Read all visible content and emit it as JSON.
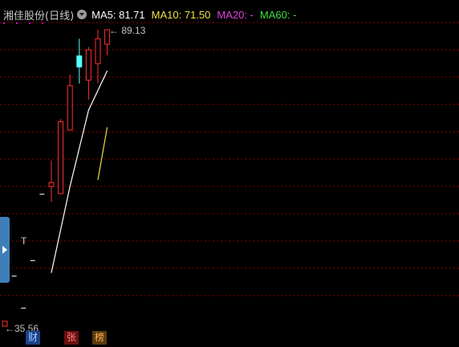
{
  "header": {
    "stock_name": "湘佳股份(日线)",
    "dropdown_icon": "chevron-down-icon",
    "ma5_label": "MA5: 81.71",
    "ma10_label": "MA10: 71.50",
    "ma20_label": "MA20: -",
    "ma60_label": "MA60: -"
  },
  "colors": {
    "background": "#000000",
    "up": "#ff3030",
    "down": "#54ffff",
    "ma5": "#ffffff",
    "ma10": "#f0e040",
    "ma20": "#e040e0",
    "ma60": "#40e040",
    "grid": "#8b0000"
  },
  "labels": {
    "high_price": "89.13",
    "low_price": "35.56",
    "marker_t": "T"
  },
  "tags": {
    "cai": "财",
    "zhang": "张",
    "bang": "榜"
  },
  "chart_data": {
    "type": "candlestick",
    "ylim": [
      35.56,
      89.13
    ],
    "candles": [
      {
        "open": 35.56,
        "close": 36.45,
        "high": 36.45,
        "low": 35.56
      },
      {
        "open": 44.6,
        "close": 44.6,
        "high": 44.6,
        "low": 44.6
      },
      {
        "open": 38.8,
        "close": 38.8,
        "high": 38.8,
        "low": 38.8
      },
      {
        "open": 47.4,
        "close": 47.4,
        "high": 47.4,
        "low": 47.4
      },
      {
        "open": 59.4,
        "close": 59.4,
        "high": 59.4,
        "low": 59.4
      },
      {
        "open": 60.8,
        "close": 61.5,
        "high": 65.5,
        "low": 58.0
      },
      {
        "open": 59.5,
        "close": 72.5,
        "high": 73.0,
        "low": 59.5
      },
      {
        "open": 71.0,
        "close": 79.0,
        "high": 81.0,
        "low": 71.0
      },
      {
        "open": 84.4,
        "close": 82.4,
        "high": 87.5,
        "low": 79.4
      },
      {
        "open": 80.0,
        "close": 85.5,
        "high": 86.0,
        "low": 76.5
      },
      {
        "open": 83.0,
        "close": 87.5,
        "high": 89.13,
        "low": 79.5
      },
      {
        "open": 86.5,
        "close": 89.13,
        "high": 89.13,
        "low": 84.5
      }
    ],
    "ma5": [
      [
        5,
        45.2
      ],
      [
        7,
        60.8
      ],
      [
        9,
        74.6
      ],
      [
        11,
        81.71
      ]
    ],
    "ma10": [
      [
        10,
        62.0
      ],
      [
        11,
        71.5
      ]
    ]
  }
}
